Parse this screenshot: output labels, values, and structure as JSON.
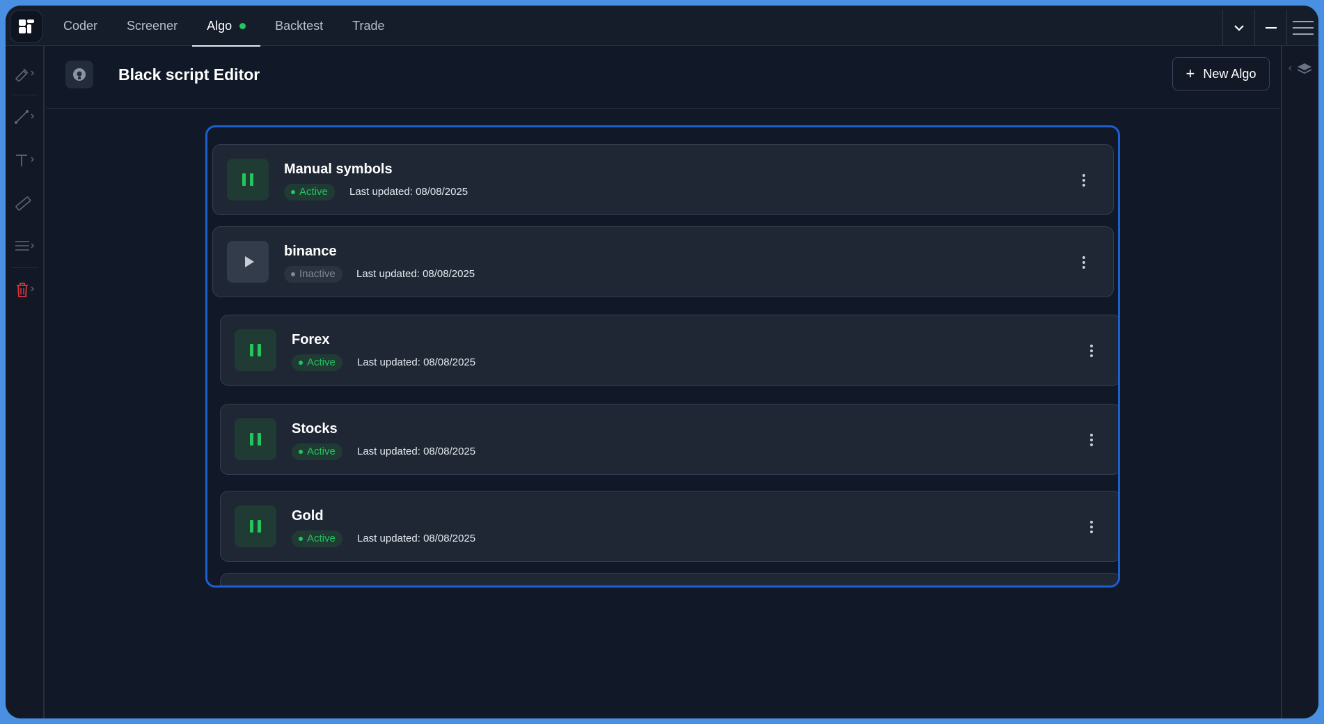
{
  "topbar": {
    "tabs": [
      {
        "label": "Coder"
      },
      {
        "label": "Screener"
      },
      {
        "label": "Algo"
      },
      {
        "label": "Backtest"
      },
      {
        "label": "Trade"
      }
    ],
    "active_tab": "Algo",
    "status_color": "#22c55e"
  },
  "left_tools": [
    "pen-icon",
    "line-icon",
    "text-icon",
    "ruler-icon",
    "lines-icon",
    "trash-icon"
  ],
  "panel": {
    "title": "Black script Editor",
    "new_button_label": "New Algo",
    "new_button_icon": "plus-icon"
  },
  "algos": [
    {
      "name": "Manual symbols",
      "status": "Active",
      "updated": "Last updated: 08/08/2025"
    },
    {
      "name": "binance",
      "status": "Inactive",
      "updated": "Last updated: 08/08/2025"
    },
    {
      "name": "Forex",
      "status": "Active",
      "updated": "Last updated: 08/08/2025"
    },
    {
      "name": "Stocks",
      "status": "Active",
      "updated": "Last updated: 08/08/2025"
    },
    {
      "name": "Gold",
      "status": "Active",
      "updated": "Last updated: 08/08/2025"
    }
  ],
  "colors": {
    "accent_green": "#22c55e",
    "highlight_blue": "#1d5fd1",
    "background": "#111827",
    "card": "#1f2735"
  }
}
